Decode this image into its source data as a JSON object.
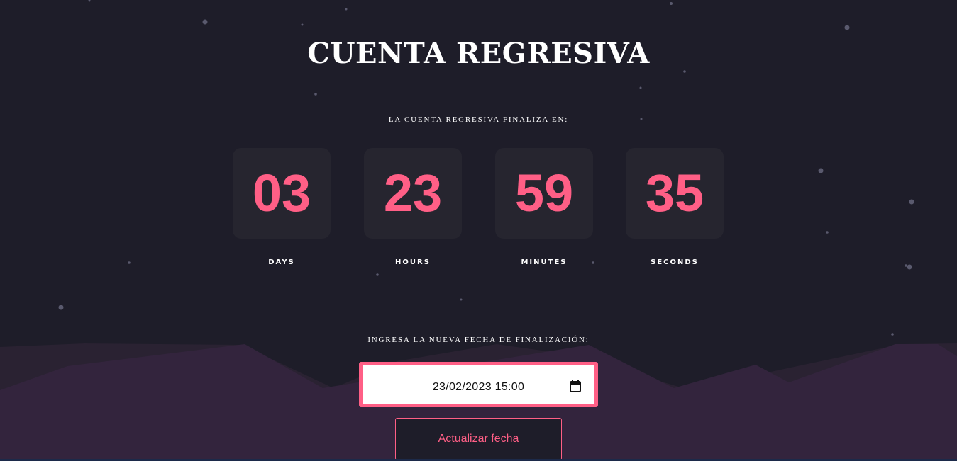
{
  "page": {
    "title": "CUENTA REGRESIVA",
    "subtitle": "LA CUENTA REGRESIVA FINALIZA EN:"
  },
  "countdown": [
    {
      "value": "03",
      "label": "DAYS"
    },
    {
      "value": "23",
      "label": "HOURS"
    },
    {
      "value": "59",
      "label": "MINUTES"
    },
    {
      "value": "35",
      "label": "SECONDS"
    }
  ],
  "form": {
    "label": "INGRESA LA NUEVA FECHA DE FINALIZACIÓN:",
    "date_value": "23/02/2023 15:00",
    "button_label": "Actualizar fecha"
  },
  "colors": {
    "background": "#1e1d29",
    "card": "#26252f",
    "accent": "#ff5f86",
    "mountains": "#33243d"
  },
  "icons": {
    "date_picker": "calendar-icon"
  }
}
